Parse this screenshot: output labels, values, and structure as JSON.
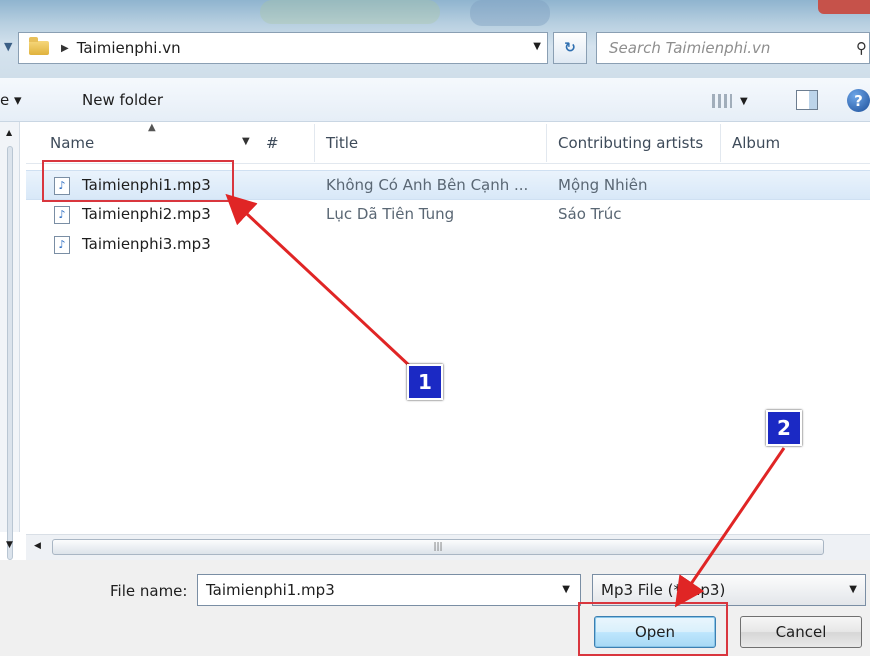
{
  "address": {
    "path": "Taimienphi.vn"
  },
  "search": {
    "placeholder": "Search Taimienphi.vn"
  },
  "toolbar": {
    "organize_label": "e ▾",
    "new_folder_label": "New folder",
    "help_label": "?"
  },
  "columns": {
    "name": "Name",
    "number": "#",
    "title": "Title",
    "artists": "Contributing artists",
    "album": "Album"
  },
  "files": [
    {
      "name": "Taimienphi1.mp3",
      "title": "Không Có Anh Bên Cạnh ...",
      "artist": "Mộng Nhiên"
    },
    {
      "name": "Taimienphi2.mp3",
      "title": "Lục Dã Tiên Tung",
      "artist": "Sáo Trúc"
    },
    {
      "name": "Taimienphi3.mp3",
      "title": "",
      "artist": ""
    }
  ],
  "bottom": {
    "file_name_label": "File name:",
    "file_name_value": "Taimienphi1.mp3",
    "file_type": "Mp3 File (*.mp3)",
    "open_label": "Open",
    "cancel_label": "Cancel"
  },
  "markers": {
    "step1": "1",
    "step2": "2"
  },
  "colors": {
    "highlight": "#d9363e",
    "marker": "#1b29c4",
    "arrow": "#e02525"
  },
  "icons": {
    "folder": "folder-icon",
    "audio": "audio-file-icon",
    "search": "search-icon",
    "refresh": "refresh-icon",
    "help": "help-icon"
  }
}
